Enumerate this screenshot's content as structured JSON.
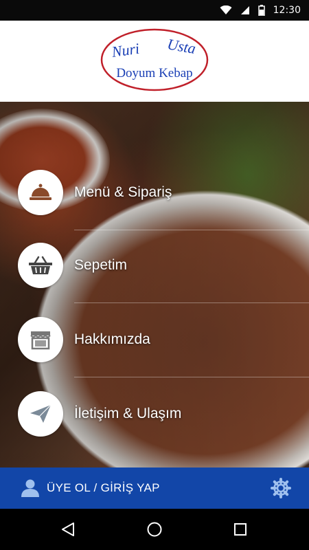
{
  "status_bar": {
    "time": "12:30",
    "icons": [
      "wifi-icon",
      "signal-icon",
      "battery-icon"
    ]
  },
  "logo": {
    "line1_a": "Nuri",
    "line1_b": "Usta",
    "line2": "Doyum Kebap",
    "color": "#1a3fb5",
    "ring_color": "#c0202a"
  },
  "menu": {
    "items": [
      {
        "label": "Menü & Sipariş",
        "icon": "cloche-icon"
      },
      {
        "label": "Sepetim",
        "icon": "basket-icon"
      },
      {
        "label": "Hakkımızda",
        "icon": "storefront-icon"
      },
      {
        "label": "İletişim & Ulaşım",
        "icon": "paper-plane-icon"
      }
    ]
  },
  "bottom_bar": {
    "login_label": "ÜYE OL / GİRİŞ YAP",
    "user_icon": "user-icon",
    "settings_icon": "gear-icon",
    "color": "#1246a8"
  },
  "navbar": {
    "buttons": [
      "back-icon",
      "home-icon",
      "recents-icon"
    ]
  }
}
